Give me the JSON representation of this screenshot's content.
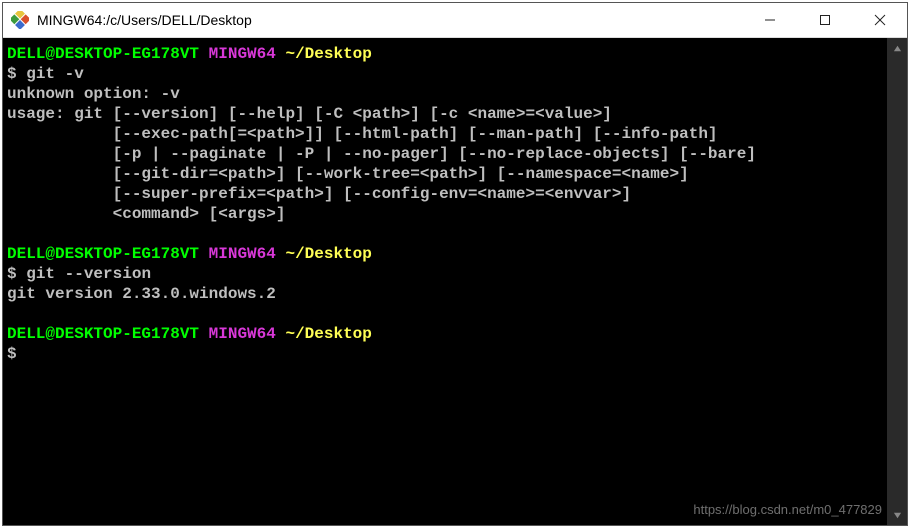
{
  "titlebar": {
    "title": "MINGW64:/c/Users/DELL/Desktop"
  },
  "prompt": {
    "user_host": "DELL@DESKTOP-EG178VT",
    "env": "MINGW64",
    "cwd": "~/Desktop",
    "sigil": "$"
  },
  "session": {
    "cmd1": "git -v",
    "out1_l1": "unknown option: -v",
    "out1_l2": "usage: git [--version] [--help] [-C <path>] [-c <name>=<value>]",
    "out1_l3": "           [--exec-path[=<path>]] [--html-path] [--man-path] [--info-path]",
    "out1_l4": "           [-p | --paginate | -P | --no-pager] [--no-replace-objects] [--bare]",
    "out1_l5": "           [--git-dir=<path>] [--work-tree=<path>] [--namespace=<name>]",
    "out1_l6": "           [--super-prefix=<path>] [--config-env=<name>=<envvar>]",
    "out1_l7": "           <command> [<args>]",
    "cmd2": "git --version",
    "out2": "git version 2.33.0.windows.2"
  },
  "watermark": "https://blog.csdn.net/m0_477829"
}
